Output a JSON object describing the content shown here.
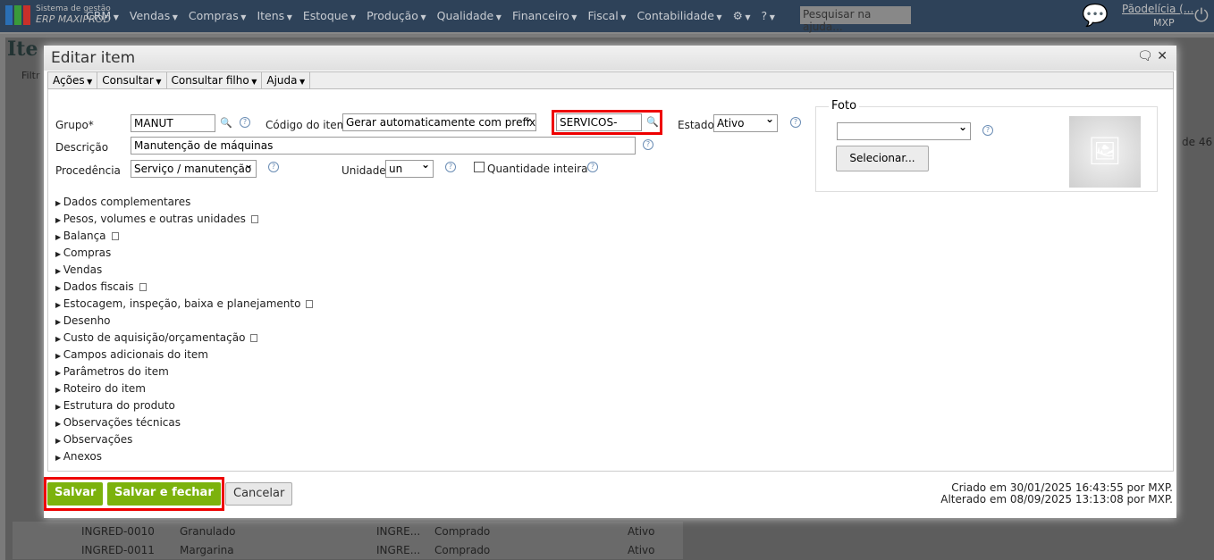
{
  "topbar": {
    "brand_small": "Sistema de gestão",
    "brand_name": "ERP MAXIPROD",
    "menu": [
      "CRM",
      "Vendas",
      "Compras",
      "Itens",
      "Estoque",
      "Produção",
      "Qualidade",
      "Financeiro",
      "Fiscal",
      "Contabilidade"
    ],
    "search_placeholder": "Pesquisar na ajuda...",
    "user": "Pãodelícia (...",
    "company": "MXP"
  },
  "background": {
    "title": "Ite",
    "filter": "Filtr",
    "pagination": "de 46",
    "rows": [
      {
        "code": "INGRED-0010",
        "desc": "Granulado",
        "group": "INGRE...",
        "origin": "Comprado",
        "state": "Ativo"
      },
      {
        "code": "INGRED-0011",
        "desc": "Margarina",
        "group": "INGRE...",
        "origin": "Comprado",
        "state": "Ativo"
      }
    ]
  },
  "dialog": {
    "title": "Editar item",
    "toolbar": [
      "Ações",
      "Consultar",
      "Consultar filho",
      "Ajuda"
    ],
    "form": {
      "grupo_label": "Grupo*",
      "grupo": "MANUT",
      "codigo_label": "Código do item",
      "codigo_mode": "Gerar automaticamente com prefixo",
      "prefixo": "SERVICOS-",
      "estado_label": "Estado",
      "estado": "Ativo",
      "descricao_label": "Descrição",
      "descricao": "Manutenção de máquinas",
      "procedencia_label": "Procedência",
      "procedencia": "Serviço / manutenção",
      "unidade_label": "Unidade",
      "unidade": "un",
      "qtd_inteira_label": "Quantidade inteira",
      "qtd_inteira": false
    },
    "foto": {
      "legend": "Foto",
      "select": "",
      "button": "Selecionar..."
    },
    "sections": [
      "Dados complementares",
      "Pesos, volumes e outras unidades",
      "Balança",
      "Compras",
      "Vendas",
      "Dados fiscais",
      "Estocagem, inspeção, baixa e planejamento",
      "Desenho",
      "Custo de aquisição/orçamentação",
      "Campos adicionais do item",
      "Parâmetros do item",
      "Roteiro do item",
      "Estrutura do produto",
      "Observações técnicas",
      "Observações",
      "Anexos"
    ],
    "buttons": {
      "save": "Salvar",
      "save_close": "Salvar e fechar",
      "cancel": "Cancelar"
    },
    "created": "Criado em 30/01/2025 16:43:55 por MXP.",
    "updated": "Alterado em 08/09/2025 13:13:08 por MXP."
  }
}
